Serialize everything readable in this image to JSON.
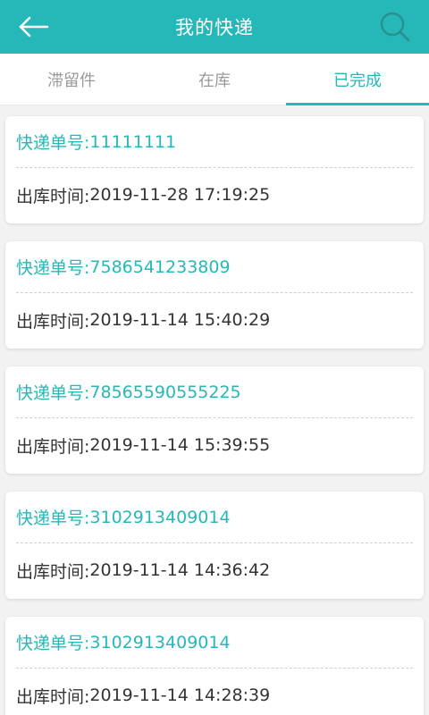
{
  "header": {
    "title": "我的快递"
  },
  "tabs": [
    {
      "label": "滞留件"
    },
    {
      "label": "在库"
    },
    {
      "label": "已完成"
    }
  ],
  "list": {
    "items": [
      {
        "tracking_label": "快递单号:",
        "tracking_number": "11111111",
        "outbound_label": "出库时间:",
        "outbound_time": "2019-11-28 17:19:25"
      },
      {
        "tracking_label": "快递单号:",
        "tracking_number": "7586541233809",
        "outbound_label": "出库时间:",
        "outbound_time": "2019-11-14 15:40:29"
      },
      {
        "tracking_label": "快递单号:",
        "tracking_number": "78565590555225",
        "outbound_label": "出库时间:",
        "outbound_time": "2019-11-14 15:39:55"
      },
      {
        "tracking_label": "快递单号:",
        "tracking_number": "3102913409014",
        "outbound_label": "出库时间:",
        "outbound_time": "2019-11-14 14:36:42"
      },
      {
        "tracking_label": "快递单号:",
        "tracking_number": "3102913409014",
        "outbound_label": "出库时间:",
        "outbound_time": "2019-11-14 14:28:39"
      }
    ]
  },
  "colors": {
    "accent": "#26b8b8",
    "text": "#333333",
    "muted": "#9a9a9a"
  },
  "icons": {
    "back": "back-arrow-icon",
    "search": "search-icon"
  }
}
